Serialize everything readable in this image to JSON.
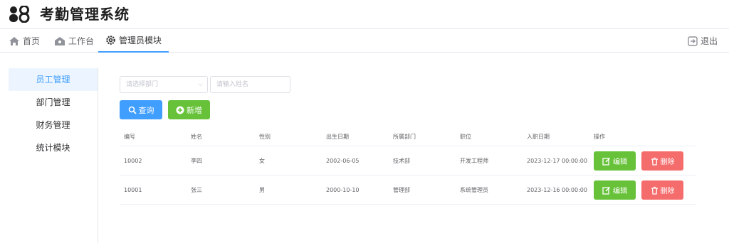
{
  "app": {
    "title": "考勤管理系统"
  },
  "nav": {
    "home_label": "首页",
    "workbench_label": "工作台",
    "admin_label": "管理员模块",
    "logout_label": "退出"
  },
  "sidebar": {
    "items": [
      {
        "label": "员工管理",
        "active": true
      },
      {
        "label": "部门管理",
        "active": false
      },
      {
        "label": "财务管理",
        "active": false
      },
      {
        "label": "统计模块",
        "active": false
      }
    ]
  },
  "filters": {
    "department_placeholder": "请选择部门",
    "name_placeholder": "请输入姓名",
    "query_label": "查询",
    "add_label": "新增"
  },
  "table": {
    "columns": [
      "编号",
      "姓名",
      "性别",
      "出生日期",
      "所属部门",
      "职位",
      "入职日期",
      "操作"
    ],
    "rows": [
      {
        "id": "10002",
        "name": "李四",
        "gender": "女",
        "birth": "2002-06-05",
        "dept": "技术部",
        "position": "开发工程师",
        "hired": "2023-12-17 00:00:00"
      },
      {
        "id": "10001",
        "name": "张三",
        "gender": "男",
        "birth": "2000-10-10",
        "dept": "管理部",
        "position": "系统管理员",
        "hired": "2023-12-16 00:00:00"
      }
    ],
    "edit_label": "编辑",
    "delete_label": "删除"
  },
  "colors": {
    "primary": "#409eff",
    "success": "#67c23a",
    "danger": "#f56c6c"
  }
}
